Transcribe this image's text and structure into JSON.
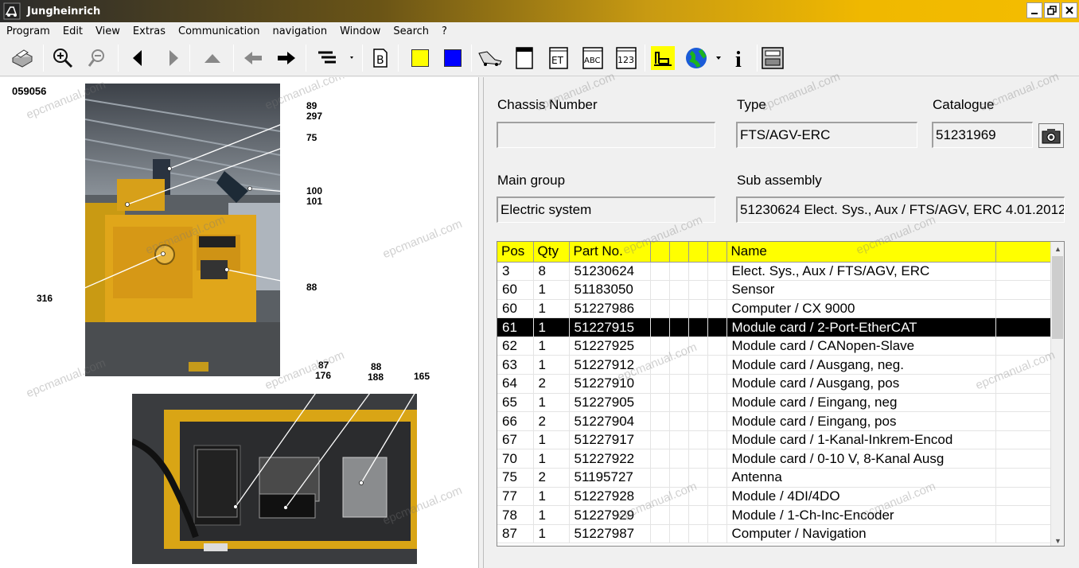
{
  "window": {
    "title": "Jungheinrich",
    "minimize_icon": "minimize-icon",
    "restore_icon": "restore-icon",
    "close_icon": "close-icon"
  },
  "menu": [
    "Program",
    "Edit",
    "View",
    "Extras",
    "Communication",
    "navigation",
    "Window",
    "Search",
    "?"
  ],
  "toolbar": {
    "icons": [
      "print-icon",
      "zoom-in-icon",
      "zoom-out-icon",
      "back-arrow-icon",
      "forward-arrow-icon",
      "up-arrow-icon",
      "previous-icon",
      "next-icon",
      "tree-view-icon",
      "bookmark-icon",
      "yellow-square-icon",
      "blue-square-icon",
      "cart-icon",
      "window-icon",
      "et-icon",
      "abc-icon",
      "123-icon",
      "forklift-icon",
      "globe-icon",
      "info-icon",
      "settings-panel-icon"
    ],
    "et_text": "ET",
    "abc_text": "ABC",
    "num_text": "123",
    "b_text": "B",
    "info_text": "i",
    "yellow": "#ffff00",
    "blue": "#0000ff"
  },
  "figure": {
    "number": "059056",
    "callouts_top": [
      "89",
      "297",
      "75",
      "100",
      "101",
      "88",
      "316"
    ],
    "callouts_bottom": [
      "87",
      "176",
      "88",
      "188",
      "165"
    ]
  },
  "form": {
    "chassis_label": "Chassis Number",
    "chassis_value": "",
    "type_label": "Type",
    "type_value": "FTS/AGV-ERC",
    "catalogue_label": "Catalogue",
    "catalogue_value": "51231969",
    "main_group_label": "Main group",
    "main_group_value": "Electric system",
    "sub_assembly_label": "Sub assembly",
    "sub_assembly_value": "51230624  Elect. Sys., Aux / FTS/AGV, ERC 4.01.2012",
    "camera_icon": "camera-icon"
  },
  "table": {
    "headers": {
      "pos": "Pos",
      "qty": "Qty",
      "part": "Part No.",
      "name": "Name"
    },
    "rows": [
      {
        "pos": "3",
        "qty": "8",
        "part": "51230624",
        "name": "Elect. Sys., Aux / FTS/AGV, ERC"
      },
      {
        "pos": "60",
        "qty": "1",
        "part": "51183050",
        "name": "Sensor"
      },
      {
        "pos": "60",
        "qty": "1",
        "part": "51227986",
        "name": "Computer / CX 9000"
      },
      {
        "pos": "61",
        "qty": "1",
        "part": "51227915",
        "name": "Module card / 2-Port-EtherCAT"
      },
      {
        "pos": "62",
        "qty": "1",
        "part": "51227925",
        "name": "Module card / CANopen-Slave"
      },
      {
        "pos": "63",
        "qty": "1",
        "part": "51227912",
        "name": "Module card / Ausgang, neg."
      },
      {
        "pos": "64",
        "qty": "2",
        "part": "51227910",
        "name": "Module card / Ausgang, pos"
      },
      {
        "pos": "65",
        "qty": "1",
        "part": "51227905",
        "name": "Module card / Eingang, neg"
      },
      {
        "pos": "66",
        "qty": "2",
        "part": "51227904",
        "name": "Module card / Eingang, pos"
      },
      {
        "pos": "67",
        "qty": "1",
        "part": "51227917",
        "name": "Module card / 1-Kanal-Inkrem-Encod"
      },
      {
        "pos": "70",
        "qty": "1",
        "part": "51227922",
        "name": "Module card / 0-10 V, 8-Kanal Ausg"
      },
      {
        "pos": "75",
        "qty": "2",
        "part": "51195727",
        "name": "Antenna"
      },
      {
        "pos": "77",
        "qty": "1",
        "part": "51227928",
        "name": "Module / 4DI/4DO"
      },
      {
        "pos": "78",
        "qty": "1",
        "part": "51227929",
        "name": "Module / 1-Ch-Inc-Encoder"
      },
      {
        "pos": "87",
        "qty": "1",
        "part": "51227987",
        "name": "Computer / Navigation"
      }
    ],
    "selected_index": 3,
    "header_color": "#ffff00"
  },
  "watermark": "epcmanual.com"
}
